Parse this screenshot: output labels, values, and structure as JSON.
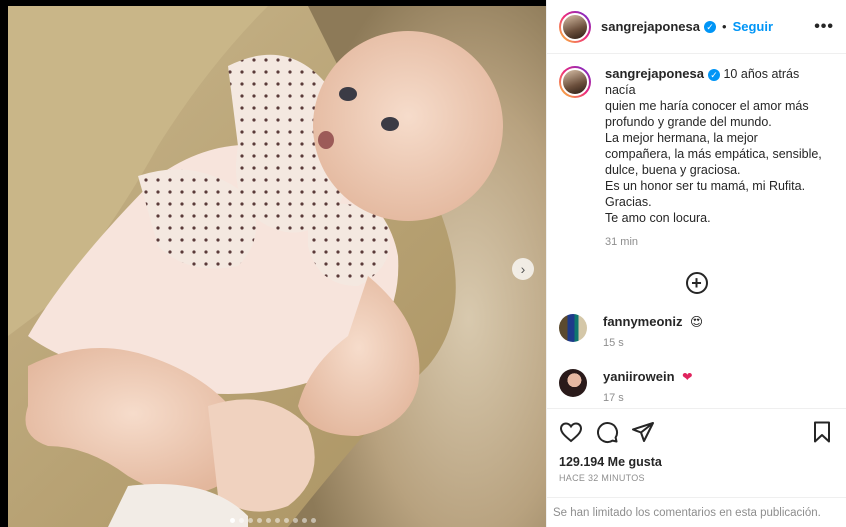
{
  "post": {
    "username": "sangrejaponesa",
    "separator": "•",
    "follow_label": "Seguir",
    "more_label": "•••",
    "next_label": "›",
    "caption_lines": [
      "10 años atrás nacía",
      "quien me haría conocer el amor más",
      "profundo y grande del mundo.",
      "La mejor hermana, la mejor",
      "compañera, la más empática, sensible,",
      "dulce, buena y graciosa.",
      "Es un honor ser tu mamá, mi Rufita.",
      "Gracias.",
      "Te amo con locura."
    ],
    "caption_time": "31 min",
    "add_label": "+",
    "verified_mark": "✓"
  },
  "comments": [
    {
      "username": "fannymeoniz",
      "emoji": "😍",
      "time": "15 s"
    },
    {
      "username": "yaniirowein",
      "emoji": "❤",
      "time": "17 s"
    }
  ],
  "actions": {
    "likes": "129.194 Me gusta",
    "posted_time": "HACE 32 MINUTOS",
    "limited_notice": "Se han limitado los comentarios en esta publicación."
  },
  "carousel": {
    "count": 10,
    "active_index": 0
  },
  "colors": {
    "accent": "#0095f6",
    "text": "#262626",
    "muted": "#8e8e8e",
    "heart": "#e0245e"
  },
  "icons": [
    "verified-icon",
    "more-icon",
    "plus-icon",
    "heart-icon",
    "comment-icon",
    "share-icon",
    "bookmark-icon",
    "chevron-right-icon"
  ]
}
